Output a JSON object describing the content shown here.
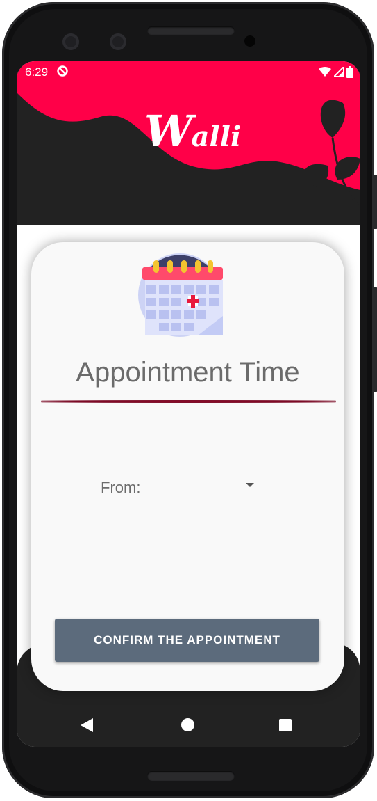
{
  "status_bar": {
    "time": "6:29"
  },
  "header": {
    "logo_main": "W",
    "logo_rest": "alli",
    "accent_color": "#ff0048",
    "dark_color": "#222222"
  },
  "card": {
    "title": "Appointment Time",
    "from_label": "From:",
    "confirm_label": "CONFIRM THE APPOINTMENT"
  },
  "colors": {
    "button": "#5c6b7c",
    "underline": "#7a0a25"
  },
  "icons": [
    "calendar-icon",
    "wifi-icon",
    "signal-icon",
    "battery-icon",
    "dnd-icon",
    "back-icon",
    "home-icon",
    "recents-icon"
  ]
}
